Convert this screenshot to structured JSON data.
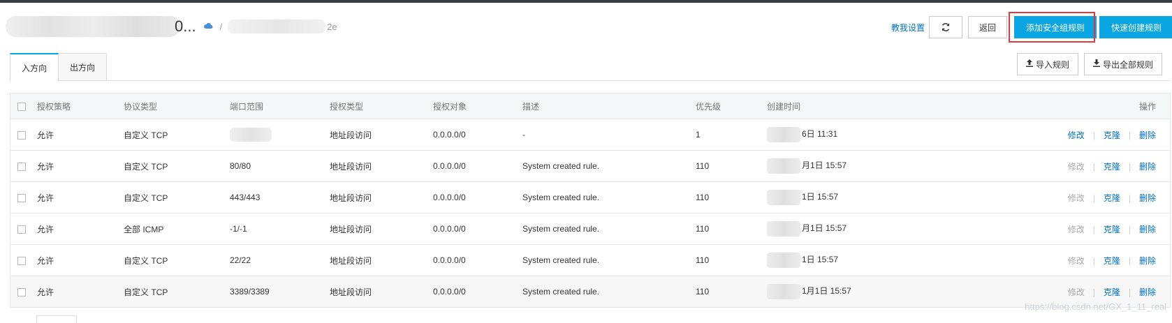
{
  "header": {
    "title_suffix": "0...",
    "id_suffix": "2e",
    "separator": "/",
    "teach_link": "教我设置",
    "back_label": "返回",
    "add_rule_label": "添加安全组规则",
    "quick_create_label": "快速创建规则",
    "refresh_icon": "refresh-icon",
    "cloud_icon": "cloud-icon",
    "highlight_color": "#e0393e",
    "primary_color": "#0aa5e3"
  },
  "tabs": [
    {
      "label": "入方向",
      "active": true
    },
    {
      "label": "出方向",
      "active": false
    }
  ],
  "actions": {
    "import_label": "导入规则",
    "export_label": "导出全部规则"
  },
  "table": {
    "columns": [
      "授权策略",
      "协议类型",
      "端口范围",
      "授权类型",
      "授权对象",
      "描述",
      "优先级",
      "创建时间",
      "操作"
    ],
    "rows": [
      {
        "policy": "允许",
        "protocol": "自定义 TCP",
        "port": "",
        "auth_type": "地址段访问",
        "object": "0.0.0.0/0",
        "desc": "-",
        "priority": "1",
        "time": "6日 11:31",
        "edit": "修改",
        "clone": "克隆",
        "delete": "删除",
        "edit_enabled": true
      },
      {
        "policy": "允许",
        "protocol": "自定义 TCP",
        "port": "80/80",
        "auth_type": "地址段访问",
        "object": "0.0.0.0/0",
        "desc": "System created rule.",
        "priority": "110",
        "time": "月1日 15:57",
        "edit": "修改",
        "clone": "克隆",
        "delete": "删除",
        "edit_enabled": false
      },
      {
        "policy": "允许",
        "protocol": "自定义 TCP",
        "port": "443/443",
        "auth_type": "地址段访问",
        "object": "0.0.0.0/0",
        "desc": "System created rule.",
        "priority": "110",
        "time": "1日 15:57",
        "edit": "修改",
        "clone": "克隆",
        "delete": "删除",
        "edit_enabled": false
      },
      {
        "policy": "允许",
        "protocol": "全部 ICMP",
        "port": "-1/-1",
        "auth_type": "地址段访问",
        "object": "0.0.0.0/0",
        "desc": "System created rule.",
        "priority": "110",
        "time": "月1日 15:57",
        "edit": "修改",
        "clone": "克隆",
        "delete": "删除",
        "edit_enabled": false
      },
      {
        "policy": "允许",
        "protocol": "自定义 TCP",
        "port": "22/22",
        "auth_type": "地址段访问",
        "object": "0.0.0.0/0",
        "desc": "System created rule.",
        "priority": "110",
        "time": "1日 15:57",
        "edit": "修改",
        "clone": "克隆",
        "delete": "删除",
        "edit_enabled": false
      },
      {
        "policy": "允许",
        "protocol": "自定义 TCP",
        "port": "3389/3389",
        "auth_type": "地址段访问",
        "object": "0.0.0.0/0",
        "desc": "System created rule.",
        "priority": "110",
        "time": "1月1日 15:57",
        "edit": "修改",
        "clone": "克隆",
        "delete": "删除",
        "edit_enabled": false
      }
    ]
  },
  "watermark": "https://blog.csdn.net/GX_1_11_real"
}
